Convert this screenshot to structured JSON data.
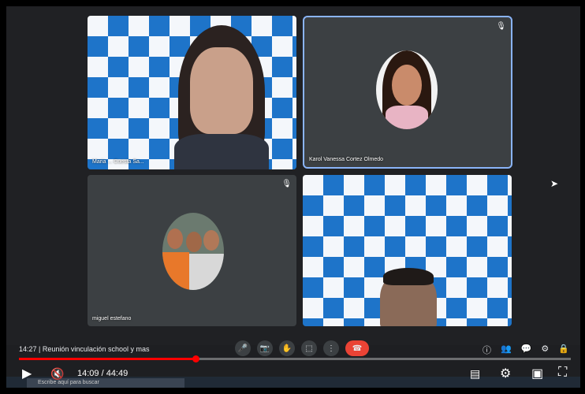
{
  "participants": [
    {
      "name": "Maria ... Cuesta Sa...",
      "muted": false
    },
    {
      "name": "Karol Vanessa Cortez Olmedo",
      "muted": true
    },
    {
      "name": "miguel estefano",
      "muted": true
    },
    {
      "name": "",
      "muted": false
    }
  ],
  "meeting": {
    "clock": "14:27",
    "title": "Reunión vinculación school y mas"
  },
  "player": {
    "current": "14:09",
    "duration": "44:49",
    "time_display": "14:09 / 44:49",
    "progress": 0.32
  },
  "taskbar": {
    "search_placeholder": "Escribe aquí para buscar"
  },
  "colors": {
    "accent": "#8ab4f8",
    "end_call": "#ea4335",
    "progress": "#ff0000"
  }
}
